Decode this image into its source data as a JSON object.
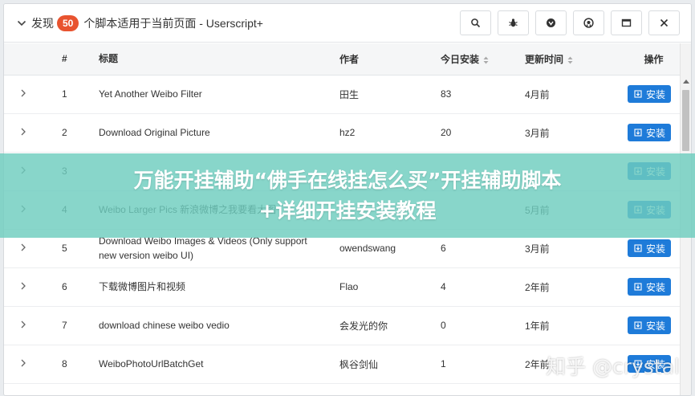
{
  "header": {
    "label": "发现",
    "count": "50",
    "title": "个脚本适用于当前页面 - Userscript+",
    "tools": [
      {
        "name": "search-icon"
      },
      {
        "name": "bug-icon"
      },
      {
        "name": "greasyfork-icon"
      },
      {
        "name": "github-icon"
      },
      {
        "name": "window-icon"
      },
      {
        "name": "close-icon"
      }
    ]
  },
  "table": {
    "columns": {
      "num": "#",
      "title": "标题",
      "author": "作者",
      "installs": "今日安装",
      "updated": "更新时间",
      "actions": "操作"
    },
    "install_label": "安装",
    "rows": [
      {
        "num": "1",
        "title": "Yet Another Weibo Filter",
        "author": "田生",
        "installs": "83",
        "updated": "4月前"
      },
      {
        "num": "2",
        "title": "Download Original Picture",
        "author": "hz2",
        "installs": "20",
        "updated": "3月前"
      },
      {
        "num": "3",
        "title": "",
        "author": "",
        "installs": "",
        "updated": ""
      },
      {
        "num": "4",
        "title": "Weibo Larger Pics 新浪微博之我要看大图",
        "author": "",
        "installs": "",
        "updated": "5月前"
      },
      {
        "num": "5",
        "title": "Download Weibo Images & Videos (Only support new version weibo UI)",
        "author": "owendswang",
        "installs": "6",
        "updated": "3月前"
      },
      {
        "num": "6",
        "title": "下载微博图片和视频",
        "author": "Flao",
        "installs": "4",
        "updated": "2年前"
      },
      {
        "num": "7",
        "title": "download chinese weibo vedio",
        "author": "会发光的你",
        "installs": "0",
        "updated": "1年前"
      },
      {
        "num": "8",
        "title": "WeiboPhotoUrlBatchGet",
        "author": "枫谷剑仙",
        "installs": "1",
        "updated": "2年前"
      }
    ]
  },
  "banner": {
    "line1": "万能开挂辅助“佛手在线挂怎么买”开挂辅助脚本",
    "line2": "+详细开挂安装教程"
  },
  "watermark": "知乎 @crystal",
  "colors": {
    "badge": "#e8532f",
    "button": "#1e7bd9",
    "banner": "#6ecdbe"
  }
}
